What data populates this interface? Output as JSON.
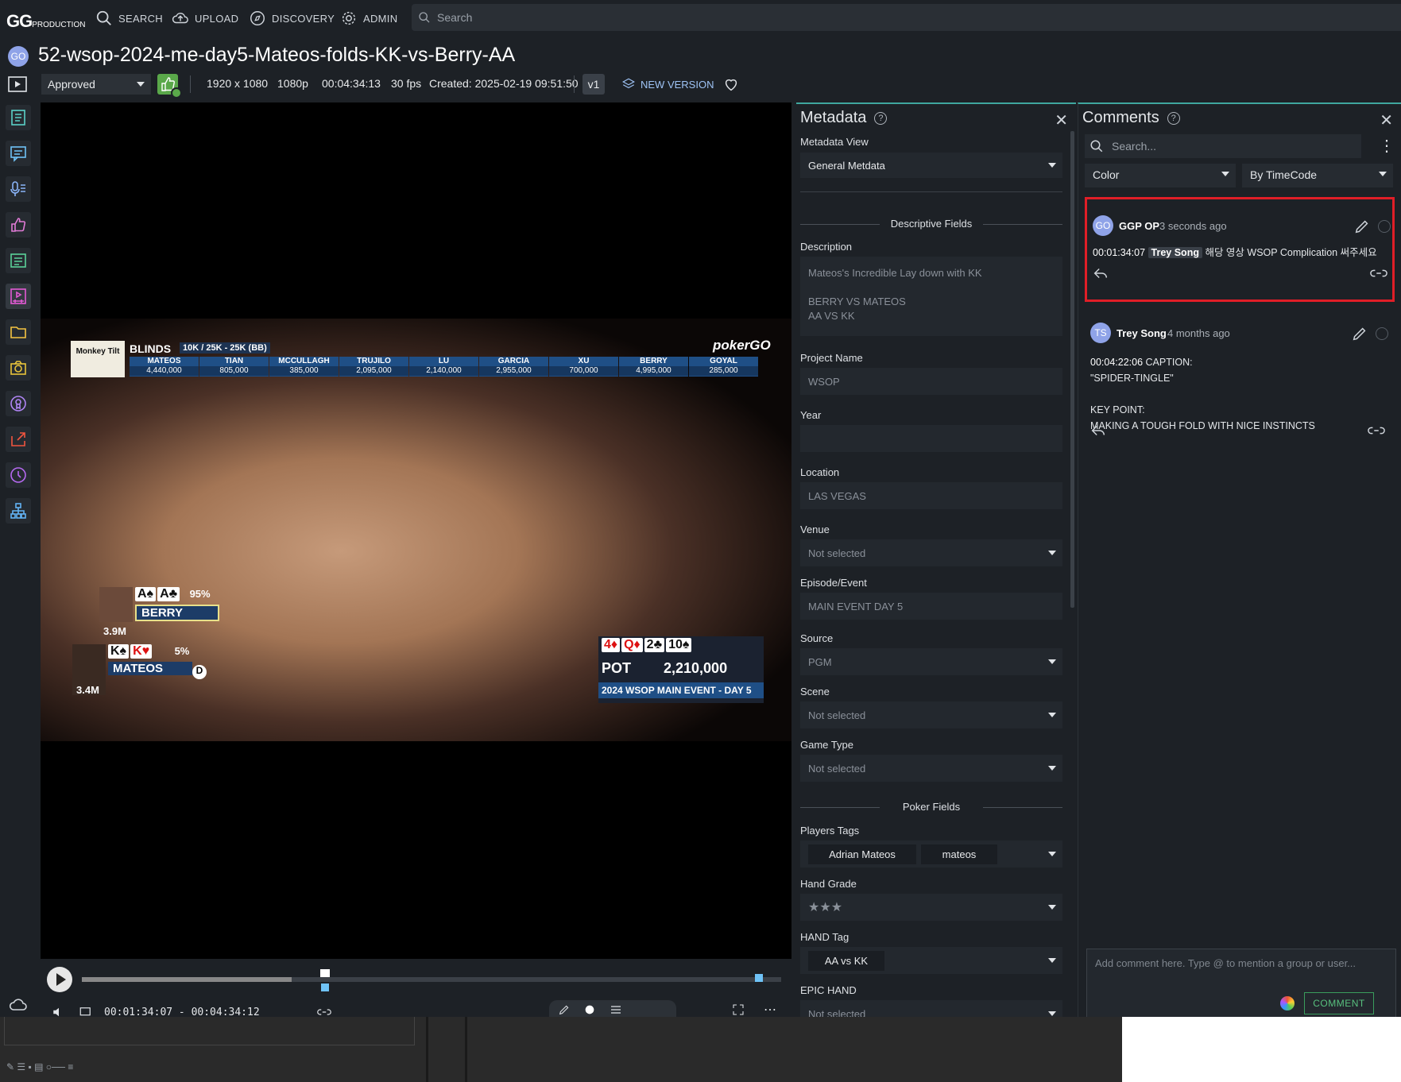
{
  "nav": {
    "logo_main": "GG",
    "logo_sub": "PRODUCTION",
    "items": [
      "SEARCH",
      "UPLOAD",
      "DISCOVERY",
      "ADMIN"
    ],
    "search_placeholder": "Search"
  },
  "asset": {
    "avatar": "GO",
    "title": "52-wsop-2024-me-day5-Mateos-folds-KK-vs-Berry-AA",
    "status": "Approved",
    "resolution": "1920 x 1080",
    "quality": "1080p",
    "duration": "00:04:34:13",
    "fps": "30 fps",
    "created": "Created: 2025-02-19 09:51:50",
    "version": "v1",
    "new_version": "NEW VERSION"
  },
  "hud": {
    "blinds_label": "BLINDS",
    "blinds_value": "10K / 25K - 25K (BB)",
    "sponsor": "Monkey Tilt",
    "brand": "pokerGO",
    "players": [
      {
        "name": "MATEOS",
        "stack": "4,440,000"
      },
      {
        "name": "TIAN",
        "stack": "805,000"
      },
      {
        "name": "MCCULLAGH",
        "stack": "385,000"
      },
      {
        "name": "TRUJILO",
        "stack": "2,095,000"
      },
      {
        "name": "LU",
        "stack": "2,140,000"
      },
      {
        "name": "GARCIA",
        "stack": "2,955,000"
      },
      {
        "name": "XU",
        "stack": "700,000"
      },
      {
        "name": "BERRY",
        "stack": "4,995,000"
      },
      {
        "name": "GOYAL",
        "stack": "285,000"
      }
    ],
    "berry": {
      "cards": [
        "A♠",
        "A♣"
      ],
      "pct": "95%",
      "name": "BERRY",
      "stack": "3.9M"
    },
    "mateos": {
      "cards": [
        "K♠",
        "K♥"
      ],
      "pct": "5%",
      "name": "MATEOS",
      "stack": "3.4M",
      "dealer": "D"
    },
    "board": [
      "4♦",
      "Q♦",
      "2♣",
      "10♠"
    ],
    "pot_label": "POT",
    "pot_value": "2,210,000",
    "event": "2024 WSOP MAIN EVENT - DAY 5"
  },
  "player": {
    "timecode": "00:01:34:07 - 00:04:34:12",
    "progress": 0.3
  },
  "metadata": {
    "title": "Metadata",
    "view_label": "Metadata View",
    "view_value": "General Metdata",
    "section_descriptive": "Descriptive Fields",
    "description_label": "Description",
    "description_line1": "Mateos's Incredible Lay down with KK",
    "description_line2": "BERRY VS MATEOS",
    "description_line3": "AA VS KK",
    "project_label": "Project Name",
    "project_value": "WSOP",
    "year_label": "Year",
    "year_value": "",
    "location_label": "Location",
    "location_value": "LAS VEGAS",
    "venue_label": "Venue",
    "venue_value": "Not selected",
    "episode_label": "Episode/Event",
    "episode_value": "MAIN EVENT DAY 5",
    "source_label": "Source",
    "source_value": "PGM",
    "scene_label": "Scene",
    "scene_value": "Not selected",
    "gametype_label": "Game Type",
    "gametype_value": "Not selected",
    "section_poker": "Poker Fields",
    "players_label": "Players Tags",
    "players_tags": [
      "Adrian Mateos",
      "mateos"
    ],
    "handgrade_label": "Hand Grade",
    "handgrade_value": "★★★",
    "handtag_label": "HAND Tag",
    "handtag_value": "AA vs KK",
    "epic_label": "EPIC HAND",
    "epic_value": "Not selected"
  },
  "comments": {
    "title": "Comments",
    "search_placeholder": "Search...",
    "filter_color": "Color",
    "filter_sort": "By TimeCode",
    "items": [
      {
        "avatar": "GO",
        "author": "GGP OP",
        "age": "3 seconds ago",
        "time": "00:01:34:07",
        "mention": "Trey Song",
        "text": "해당 영상 WSOP Complication 써주세요"
      },
      {
        "avatar": "TS",
        "author": "Trey Song",
        "age": "4 months ago",
        "time": "00:04:22:06",
        "line1": "CAPTION:",
        "line2": "\"SPIDER-TINGLE\"",
        "line3": "KEY POINT:",
        "line4": "MAKING A TOUGH FOLD WITH NICE INSTINCTS"
      }
    ],
    "add_placeholder": "Add comment here. Type @ to mention a group or user...",
    "button": "COMMENT"
  },
  "colors": {
    "accent": "#3fa79f",
    "highlight": "#e01e27",
    "approve": "#5aa84a",
    "link": "#9ec3f5"
  }
}
